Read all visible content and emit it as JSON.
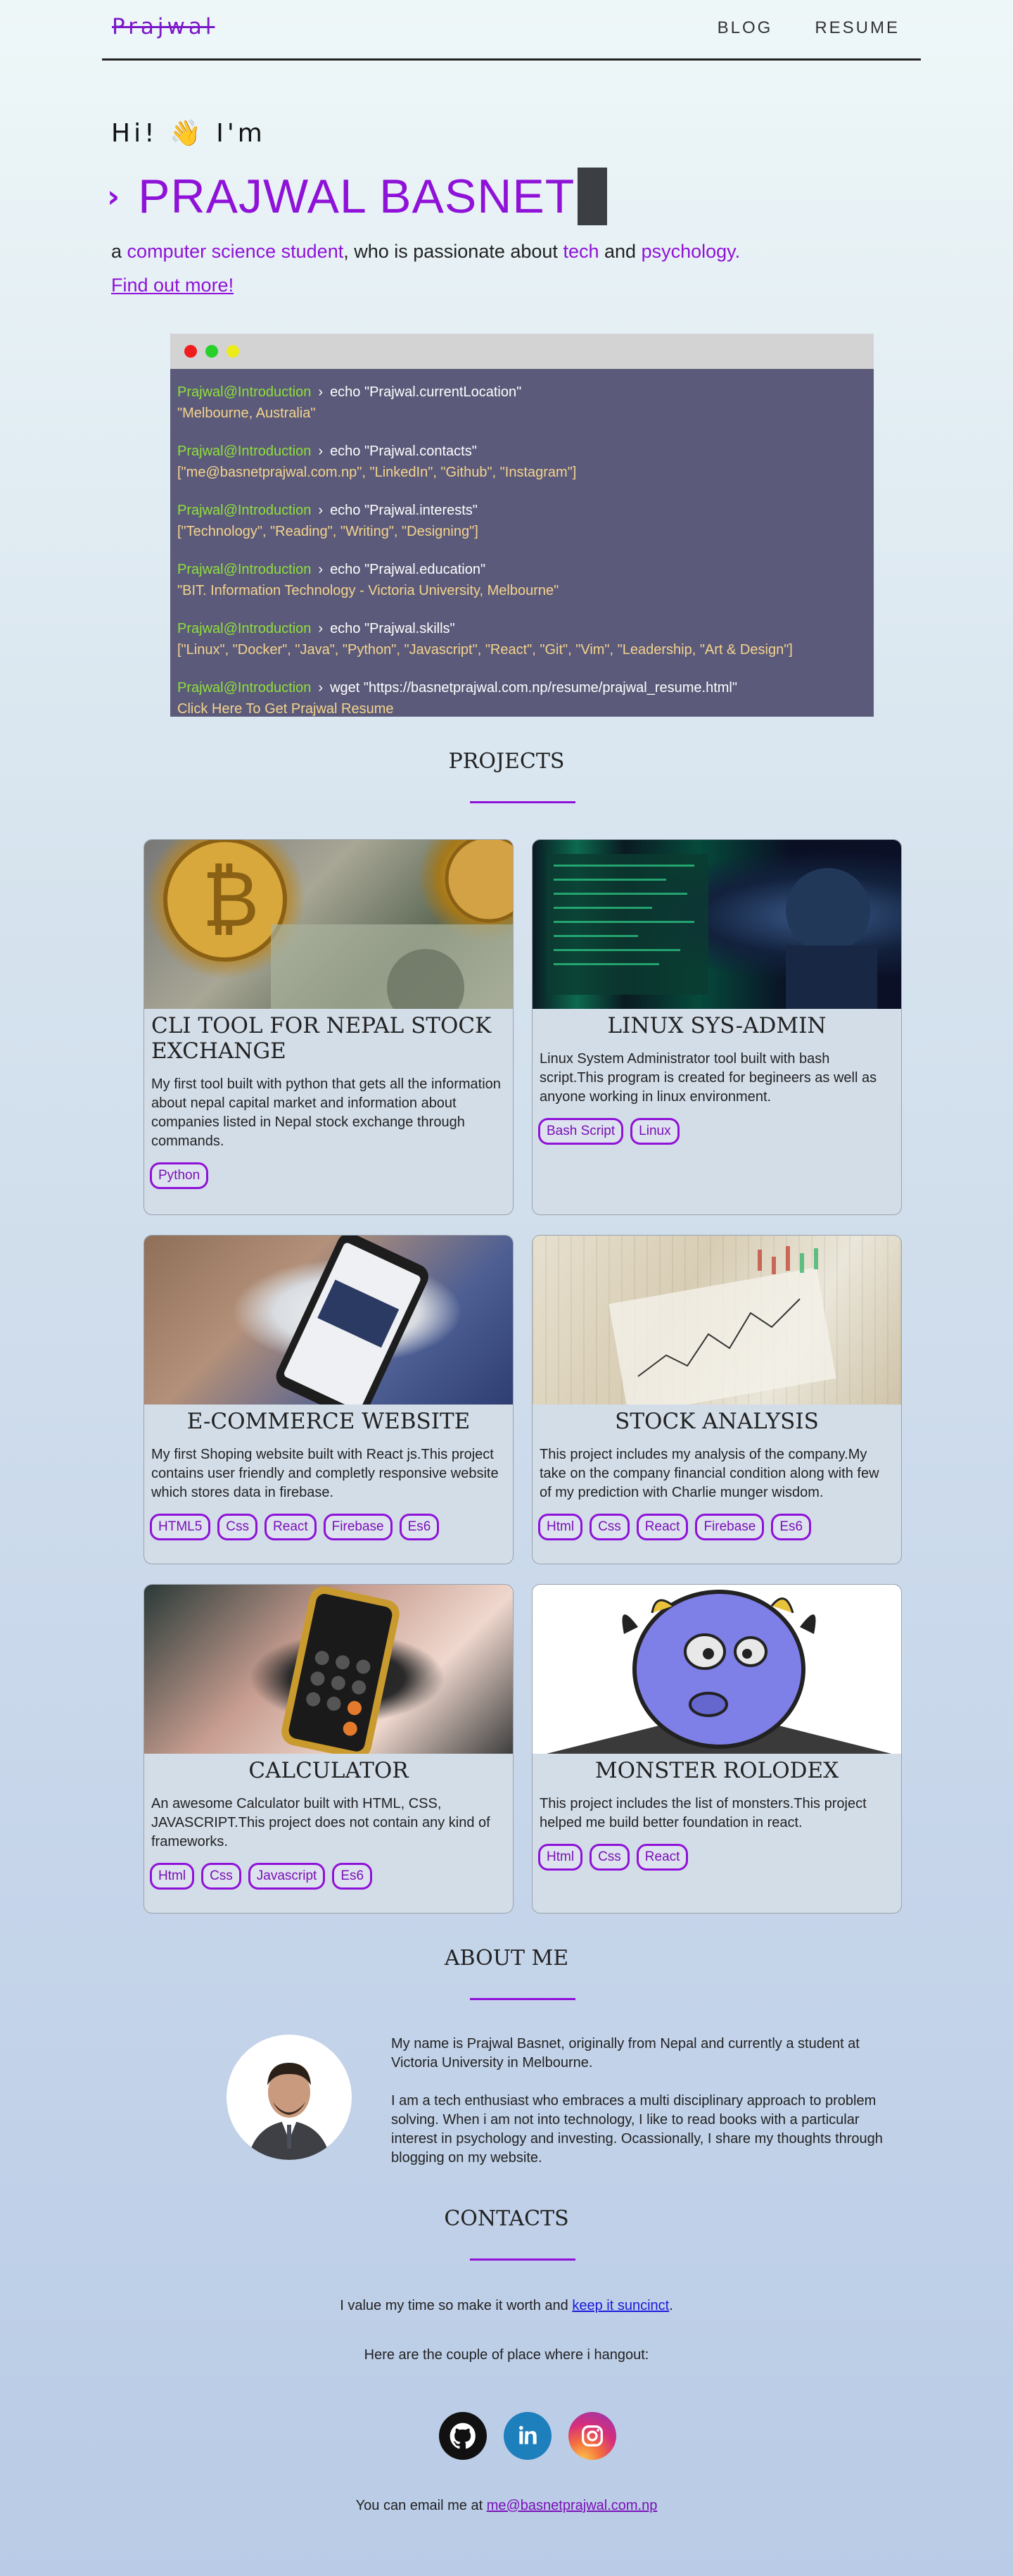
{
  "nav": {
    "logo": "Prajwal",
    "links": [
      "BLOG",
      "RESUME"
    ]
  },
  "hero": {
    "greeting": "Hi! 👋 I'm",
    "prompt_symbol": "›",
    "name": "PRAJWAL BASNET",
    "intro_prefix": "a",
    "intro_hl1": "computer science student",
    "intro_mid": ", who is passionate about",
    "intro_hl2": "tech",
    "intro_and": "and",
    "intro_hl3": "psychology.",
    "find_more": "Find out more!"
  },
  "terminal": {
    "entries": [
      {
        "user": "Prajwal@Introduction",
        "cmd": "echo \"Prajwal.currentLocation\"",
        "out": "\"Melbourne, Australia\""
      },
      {
        "user": "Prajwal@Introduction",
        "cmd": "echo \"Prajwal.contacts\"",
        "out": "[\"me@basnetprajwal.com.np\",  \"LinkedIn\", \"Github\", \"Instagram\"]"
      },
      {
        "user": "Prajwal@Introduction",
        "cmd": "echo \"Prajwal.interests\"",
        "out": "[\"Technology\",  \"Reading\", \"Writing\", \"Designing\"]"
      },
      {
        "user": "Prajwal@Introduction",
        "cmd": "echo \"Prajwal.education\"",
        "out": "\"BIT. Information Technology - Victoria University, Melbourne\""
      },
      {
        "user": "Prajwal@Introduction",
        "cmd": "echo \"Prajwal.skills\"",
        "out": "[\"Linux\", \"Docker\", \"Java\", \"Python\", \"Javascript\", \"React\", \"Git\", \"Vim\", \"Leadership, \"Art & Design\"]"
      },
      {
        "user": "Prajwal@Introduction",
        "cmd": "wget \"https://basnetprajwal.com.np/resume/prajwal_resume.html\"",
        "out": "Click Here To Get Prajwal Resume"
      }
    ]
  },
  "projects": {
    "title": "PROJECTS",
    "items": [
      {
        "title": "CLI TOOL FOR NEPAL STOCK EXCHANGE",
        "desc": "My first tool built with python that gets all the information about nepal capital market and information about companies listed in Nepal stock exchange through commands.",
        "tags": [
          "Python"
        ]
      },
      {
        "title": "LINUX SYS-ADMIN",
        "desc": "Linux System Administrator tool built with bash script.This program is created for begineers as well as anyone working in linux environment.",
        "tags": [
          "Bash Script",
          "Linux"
        ]
      },
      {
        "title": "E-COMMERCE WEBSITE",
        "desc": "My first Shoping website built with React js.This project contains user friendly and completly responsive website which stores data in firebase.",
        "tags": [
          "HTML5",
          "Css",
          "React",
          "Firebase",
          "Es6"
        ]
      },
      {
        "title": "STOCK ANALYSIS",
        "desc": "This project includes my analysis of the company.My take on the company financial condition along with few of my prediction with Charlie munger wisdom.",
        "tags": [
          "Html",
          "Css",
          "React",
          "Firebase",
          "Es6"
        ]
      },
      {
        "title": "CALCULATOR",
        "desc": "An awesome Calculator built with HTML, CSS, JAVASCRIPT.This project does not contain any kind of frameworks.",
        "tags": [
          "Html",
          "Css",
          "Javascript",
          "Es6"
        ]
      },
      {
        "title": "MONSTER ROLODEX",
        "desc": "This project includes the list of monsters.This project helped me build better foundation in react.",
        "tags": [
          "Html",
          "Css",
          "React"
        ]
      }
    ]
  },
  "about": {
    "title": "ABOUT ME",
    "p1": "My name is Prajwal Basnet, originally from Nepal and currently a student at Victoria University in Melbourne.",
    "p2": "I am a tech enthusiast who embraces a multi disciplinary approach to problem solving. When i am not into technology, I like to read books with a particular interest in psychology and investing. Ocassionally, I share my thoughts through blogging on my website."
  },
  "contacts": {
    "title": "CONTACTS",
    "line1_prefix": "I value my time so make it worth and",
    "line1_link": "keep it suncinct",
    "line1_suffix": ".",
    "line2": "Here are the couple of place where i hangout:",
    "email_prefix": "You can email me at",
    "email": "me@basnetprajwal.com.np",
    "socials": [
      "github-icon",
      "linkedin-icon",
      "instagram-icon"
    ]
  }
}
